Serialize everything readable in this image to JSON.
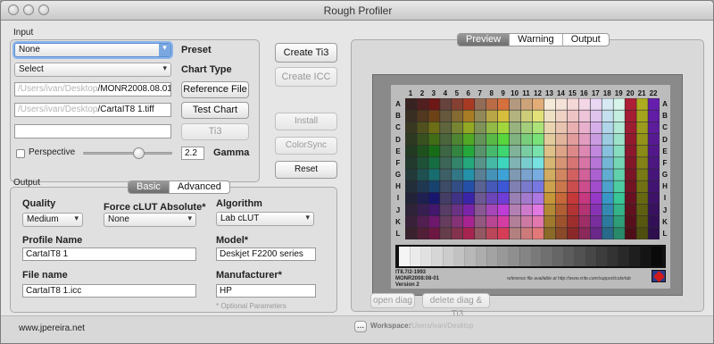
{
  "window": {
    "title": "Rough Profiler"
  },
  "input": {
    "group_label": "Input",
    "preset": {
      "value": "None",
      "label": "Preset"
    },
    "chart_type": {
      "value": "Select",
      "label": "Chart Type"
    },
    "reference_file": {
      "path_blurred": "/Users/ivan/Desktop",
      "path_visible": "/MONR2008.08.01",
      "button": "Reference File"
    },
    "test_chart": {
      "path_blurred": "/Users/ivan/Desktop",
      "path_visible": "/CartaIT8 1.tiff",
      "button": "Test Chart"
    },
    "ti3": {
      "value": "",
      "button": "Ti3"
    },
    "perspective": {
      "label": "Perspective",
      "checked": false
    },
    "gamma": {
      "value": "2.2",
      "label": "Gamma",
      "slider_fraction": 0.62
    }
  },
  "actions": {
    "create_ti3": "Create Ti3",
    "create_icc": "Create ICC",
    "install": "Install",
    "colorsync": "ColorSync",
    "reset": "Reset"
  },
  "output": {
    "group_label": "Output",
    "tabs": [
      "Basic",
      "Advanced"
    ],
    "active_tab": "Basic",
    "quality": {
      "label": "Quality",
      "value": "Medium"
    },
    "force_clut": {
      "label": "Force cLUT Absolute*",
      "value": "None"
    },
    "algorithm": {
      "label": "Algorithm",
      "value": "Lab cLUT"
    },
    "profile_name": {
      "label": "Profile Name",
      "value": "CartaIT8 1"
    },
    "model": {
      "label": "Model*",
      "value": "Deskjet F2200 series"
    },
    "file_name": {
      "label": "File name",
      "value": "CartaIT8 1.icc"
    },
    "manufacturer": {
      "label": "Manufacturer*",
      "value": "HP"
    },
    "note": "* Optional Parameters"
  },
  "preview": {
    "tabs": [
      "Preview",
      "Warning",
      "Output"
    ],
    "active_tab": "Preview",
    "open_diag": "open diag",
    "delete_diag": "delete diag & .Ti3",
    "chart": {
      "columns": [
        "1",
        "2",
        "3",
        "4",
        "5",
        "6",
        "7",
        "8",
        "9",
        "10",
        "11",
        "12",
        "13",
        "14",
        "15",
        "16",
        "17",
        "18",
        "19",
        "20",
        "21",
        "22"
      ],
      "rows": [
        "A",
        "B",
        "C",
        "D",
        "E",
        "F",
        "G",
        "H",
        "I",
        "J",
        "K",
        "L"
      ],
      "info_line1": "IT8.7/2-1993",
      "info_line2": "MONR2008:08-01",
      "info_line3": "Version 2",
      "footnote": "reference file available at http://www.xrite.com/support/colorlab"
    }
  },
  "status": {
    "site": "www.jpereira.net",
    "browse_button": "...",
    "workspace_label": "Workspace:",
    "workspace_path": "/Users/ivan/Desktop"
  }
}
